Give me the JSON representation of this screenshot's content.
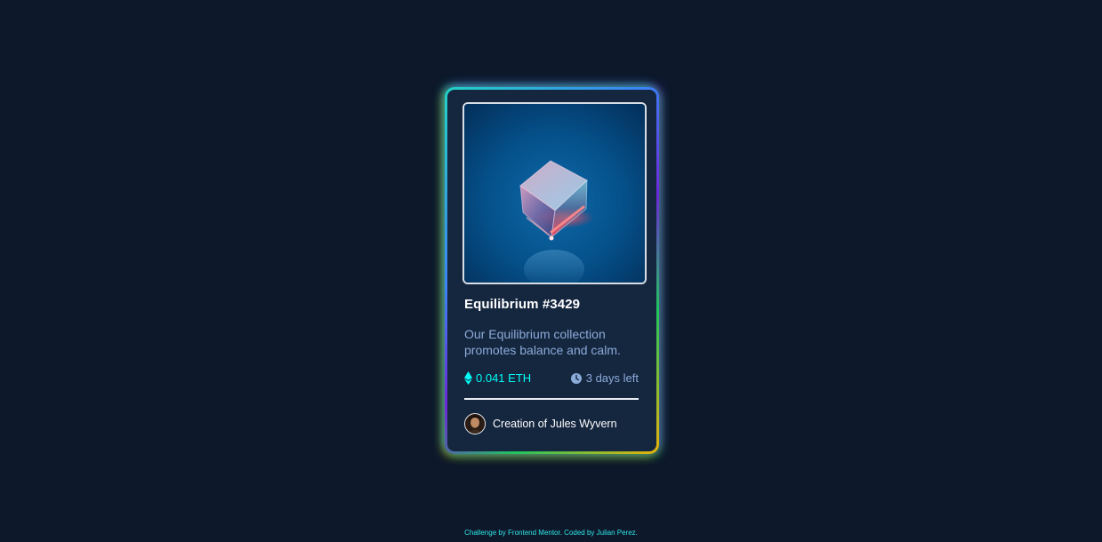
{
  "card": {
    "title": "Equilibrium #3429",
    "description": "Our Equilibrium collection promotes balance and calm.",
    "price": "0.041 ETH",
    "time_left": "3 days left",
    "creator_prefix": "Creation of",
    "creator_name": "Jules Wyvern",
    "creator_full": "Creation of Jules Wyvern"
  },
  "icons": {
    "price_icon": "ethereum-icon",
    "time_icon": "clock-icon",
    "image_subject": "glass-cube-image"
  },
  "footer": {
    "attribution": "Challenge by Frontend Mentor. Coded by Julian Perez."
  },
  "colors": {
    "background": "#0d192b",
    "card": "#15263f",
    "cyan": "#00fff8",
    "soft_blue": "#8bacd9",
    "white": "#ffffff"
  }
}
